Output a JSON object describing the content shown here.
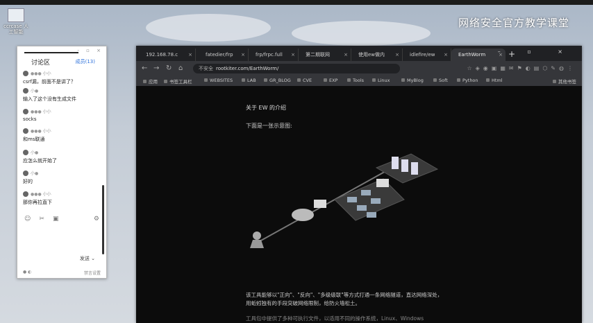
{
  "desktop": {
    "icon_label": "ccrcase\n人工智能",
    "watermark": "网络安全官方教学课堂"
  },
  "chat": {
    "title": "讨论区",
    "online": "成员(13)",
    "messages": [
      {
        "user": "●●● 小小",
        "text": "csrf漏，前面不是讲了？"
      },
      {
        "user": "小●",
        "text": "输入了这个没有生成文件"
      },
      {
        "user": "●●● 小小",
        "text": "socks"
      },
      {
        "user": "●●● 小小",
        "text": "和ms联通"
      },
      {
        "user": "小●",
        "text": "应怎么就开始了"
      },
      {
        "user": "小●",
        "text": "好的"
      },
      {
        "user": "●●● 小小",
        "text": "那你再拉直下"
      }
    ],
    "send_label": "发送",
    "footer_left": "●  ◐",
    "footer_right": "禁言设置"
  },
  "browser": {
    "tabs": [
      {
        "label": "192.168.78.c"
      },
      {
        "label": "fatedier/frp"
      },
      {
        "label": "frp/frpc.full"
      },
      {
        "label": "第二期联网"
      },
      {
        "label": "使用ew做内"
      },
      {
        "label": "idlefire/ew"
      },
      {
        "label": "EarthWorm"
      }
    ],
    "insecure": "不安全",
    "url": "rootkiter.com/EarthWorm/",
    "bookmarks": [
      "应用",
      "书签工具栏",
      "WEBSITES",
      "LAB",
      "GR_BLOG",
      "CVE",
      "EXP",
      "Tools",
      "Linux",
      "MyBlog",
      "Soft",
      "Python",
      "Html",
      "其他书签"
    ]
  },
  "page": {
    "about": "关于 EW 的介绍",
    "below": "下面是一张示意图:",
    "para_line1": "该工具能够以\"正向\"、\"反向\"、\"多级级联\"等方式打通一条网络隧道，直达网络深处，",
    "para_line2": "用蚯蚓独有的手段突破网络限制，给防火墙松土。",
    "para_line3": "工具包中提供了多种可执行文件，以适用不同的操作系统，Linux、Windows"
  }
}
